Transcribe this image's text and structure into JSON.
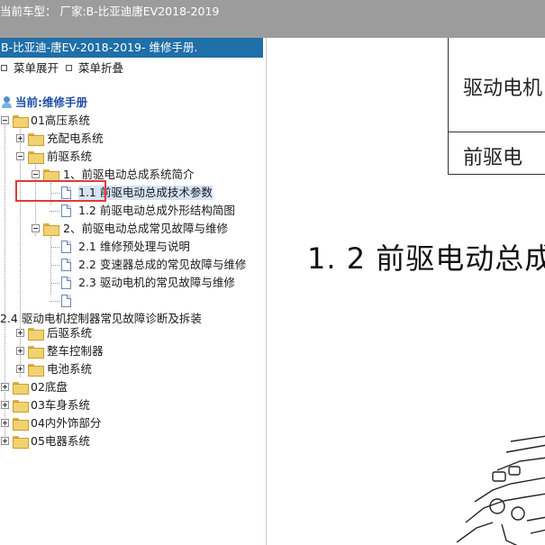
{
  "window": {
    "title": "当前车型：  厂家:B-比亚迪唐EV2018-2019"
  },
  "left_panel": {
    "doc_title": "B-比亚迪-唐EV-2018-2019- 维修手册.",
    "menu": {
      "expand_label": "菜单展开",
      "collapse_label": "菜单折叠"
    }
  },
  "tree": {
    "root_label": "当前:维修手册",
    "items": [
      "01高压系统",
      "充配电系统",
      "前驱系统",
      "1、前驱电动总成系统简介",
      "1.1 前驱电动总成技术参数",
      "1.2 前驱电动总成外形结构简图",
      "2、前驱电动总成常见故障与维修",
      "2.1 维修预处理与说明",
      "2.2 变速器总成的常见故障与维修",
      "2.3 驱动电机的常见故障与维修",
      "",
      "2.4 驱动电机控制器常见故障诊断及拆装",
      "后驱系统",
      "整车控制器",
      "电池系统",
      "02底盘",
      "03车身系统",
      "04内外饰部分",
      "05电器系统"
    ],
    "selected": "1.1 前驱电动总成技术参数",
    "highlighted": "前驱系统"
  },
  "document": {
    "table_cells": [
      "驱动电机",
      "前驱电"
    ],
    "heading": "1. 2 前驱电动总成"
  },
  "colors": {
    "titlebar": "#9c9c9c",
    "doc_header": "#1f6fa8",
    "highlight_box": "#e03a3a",
    "selection": "#d6e4f5"
  }
}
